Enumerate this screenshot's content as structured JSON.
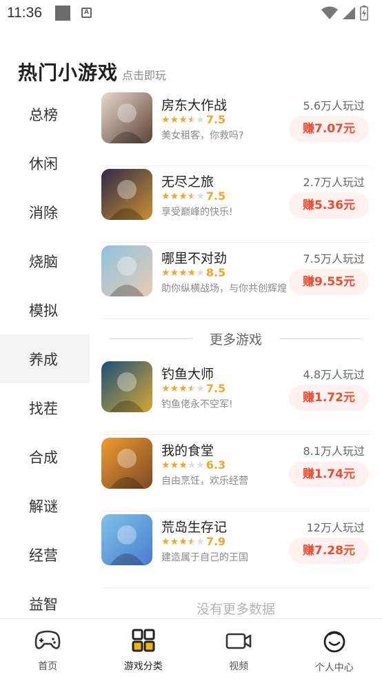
{
  "status_bar": {
    "time": "11:36"
  },
  "header": {
    "title": "热门小游戏",
    "subtitle": "点击即玩"
  },
  "sidebar": {
    "items": [
      {
        "label": "总榜"
      },
      {
        "label": "休闲"
      },
      {
        "label": "消除"
      },
      {
        "label": "烧脑"
      },
      {
        "label": "模拟"
      },
      {
        "label": "养成",
        "active": true
      },
      {
        "label": "找茬"
      },
      {
        "label": "合成"
      },
      {
        "label": "解谜"
      },
      {
        "label": "经营"
      },
      {
        "label": "益智"
      }
    ]
  },
  "hot_games": [
    {
      "name": "房东大作战",
      "rating": "7.5",
      "stars": 3.5,
      "desc": "美女租客，你救吗?",
      "plays": "5.6万人玩过",
      "earn": "赚7.07元",
      "thumb_colors": [
        "#e9d9cf",
        "#5b4137"
      ]
    },
    {
      "name": "无尽之旅",
      "rating": "7.5",
      "stars": 3.5,
      "desc": "享受巅峰的快乐!",
      "plays": "2.7万人玩过",
      "earn": "赚5.36元",
      "thumb_colors": [
        "#2f2a4a",
        "#c8902f"
      ]
    },
    {
      "name": "哪里不对劲",
      "rating": "8.5",
      "stars": 4,
      "desc": "助你纵横战场，与你共创辉煌",
      "plays": "7.5万人玩过",
      "earn": "赚9.55元",
      "thumb_colors": [
        "#8ec3de",
        "#e9cbb5"
      ]
    }
  ],
  "more_games_label": "更多游戏",
  "more_games": [
    {
      "name": "钓鱼大师",
      "rating": "7.5",
      "stars": 3.5,
      "desc": "钓鱼佬永不空军!",
      "plays": "4.8万人玩过",
      "earn": "赚1.72元",
      "thumb_colors": [
        "#1a4f7a",
        "#d7a932"
      ]
    },
    {
      "name": "我的食堂",
      "rating": "6.3",
      "stars": 3,
      "desc": "自由烹饪，欢乐经营",
      "plays": "8.1万人玩过",
      "earn": "赚1.74元",
      "thumb_colors": [
        "#f29a2e",
        "#7b4a24"
      ]
    },
    {
      "name": "荒岛生存记",
      "rating": "7.9",
      "stars": 3.5,
      "desc": "建造属于自己的王国",
      "plays": "12万人玩过",
      "earn": "赚7.28元",
      "thumb_colors": [
        "#7ec3e8",
        "#4a7bd0"
      ]
    }
  ],
  "no_more_label": "没有更多数据",
  "bottom_nav": {
    "items": [
      {
        "label": "首页",
        "icon": "gamepad-icon"
      },
      {
        "label": "游戏分类",
        "icon": "grid-icon",
        "active": true
      },
      {
        "label": "视频",
        "icon": "video-icon"
      },
      {
        "label": "个人中心",
        "icon": "smiley-icon"
      }
    ]
  },
  "colors": {
    "accent": "#f04a2f",
    "earn_bg": "#fff1ef",
    "star": "#f5a623",
    "grid_yellow": "#f2b705"
  }
}
